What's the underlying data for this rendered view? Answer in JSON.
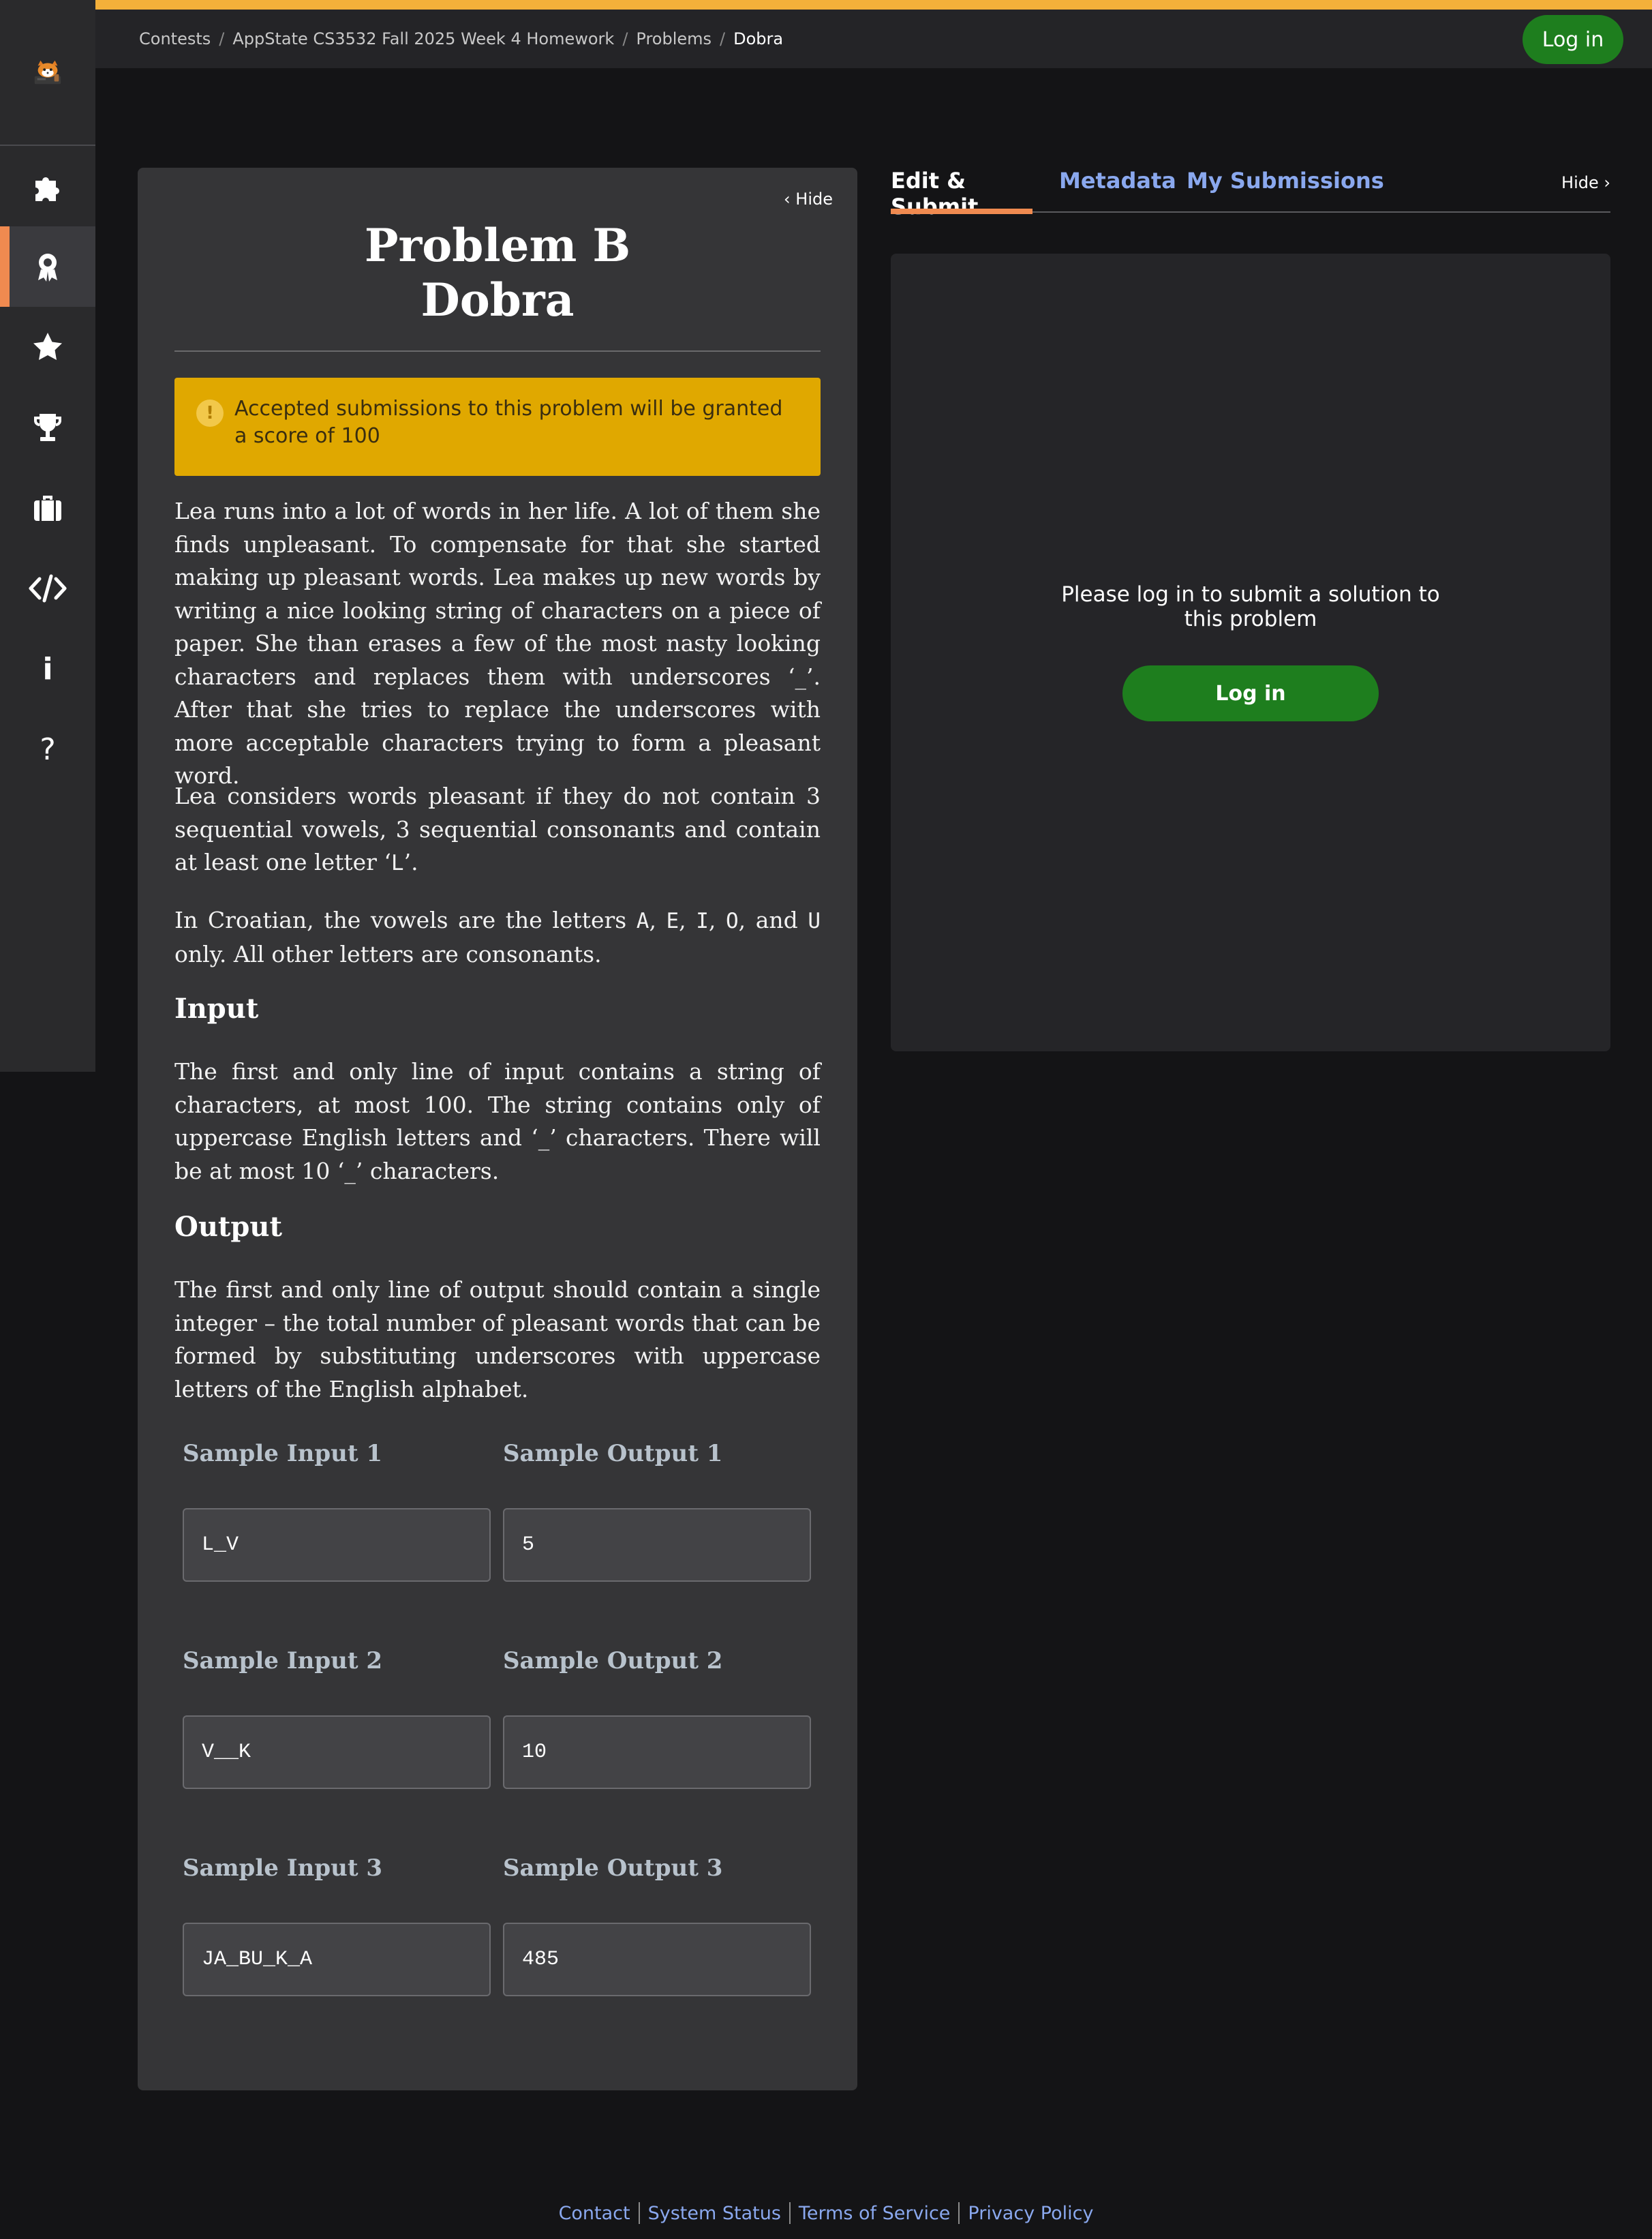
{
  "header": {
    "breadcrumb": [
      "Contests",
      "AppState CS3532 Fall 2025 Week 4 Homework",
      "Problems",
      "Dobra"
    ],
    "login_label": "Log in"
  },
  "sidebar": {
    "items": [
      {
        "icon": "puzzle-icon"
      },
      {
        "icon": "award-icon",
        "active": true
      },
      {
        "icon": "star-icon"
      },
      {
        "icon": "trophy-icon"
      },
      {
        "icon": "briefcase-icon"
      },
      {
        "icon": "code-icon"
      },
      {
        "icon": "info-icon",
        "glyph": "i"
      },
      {
        "icon": "help-icon",
        "glyph": "?"
      }
    ]
  },
  "problem": {
    "hide_label": "Hide",
    "title_line1": "Problem B",
    "title_line2": "Dobra",
    "notice": "Accepted submissions to this problem will be granted a score of 100",
    "notice_icon": "!",
    "p1": "Lea runs into a lot of words in her life. A lot of them she finds unpleasant. To compensate for that she started making up pleasant words. Lea makes up new words by writing a nice looking string of characters on a piece of paper. She than erases a few of the most nasty looking characters and replaces them with underscores ‘_’. After that she tries to replace the underscores with more acceptable characters trying to form a pleasant word.",
    "p2_a": "Lea considers words pleasant if they do not contain 3 sequential vowels, 3 sequential consonants and contain at least one letter ‘",
    "p2_l": "L",
    "p2_b": "’.",
    "p3_a": "In Croatian, the vowels are the letters ",
    "v_a": "A",
    "v_e": "E",
    "v_i": "I",
    "v_o": "O",
    "v_u": "U",
    "p3_b": " only. All other letters are consonants.",
    "input_heading": "Input",
    "input_text": "The first and only line of input contains a string of characters, at most 100. The string contains only of uppercase English letters and ‘_’ characters. There will be at most 10 ‘_’ characters.",
    "output_heading": "Output",
    "output_text": "The first and only line of output should contain a single integer – the total number of pleasant words that can be formed by substituting underscores with uppercase letters of the English alphabet.",
    "samples": [
      {
        "input_label": "Sample Input 1",
        "output_label": "Sample Output 1",
        "input": "L_V",
        "output": "5"
      },
      {
        "input_label": "Sample Input 2",
        "output_label": "Sample Output 2",
        "input": "V__K",
        "output": "10"
      },
      {
        "input_label": "Sample Input 3",
        "output_label": "Sample Output 3",
        "input": "JA_BU_K_A",
        "output": "485"
      }
    ]
  },
  "right": {
    "tabs": [
      "Edit & Submit",
      "Metadata",
      "My Submissions"
    ],
    "hide_label": "Hide",
    "message_line1": "Please log in to submit a solution to",
    "message_line2": "this problem",
    "login_label": "Log in"
  },
  "footer": {
    "links": [
      "Contact",
      "System Status",
      "Terms of Service",
      "Privacy Policy"
    ]
  },
  "colors": {
    "accent_orange": "#f4b03a",
    "active_tab": "#f08a50",
    "login_green": "#1e7e1e",
    "notice_yellow": "#e0a800",
    "link_blue": "#8aa8ee"
  }
}
